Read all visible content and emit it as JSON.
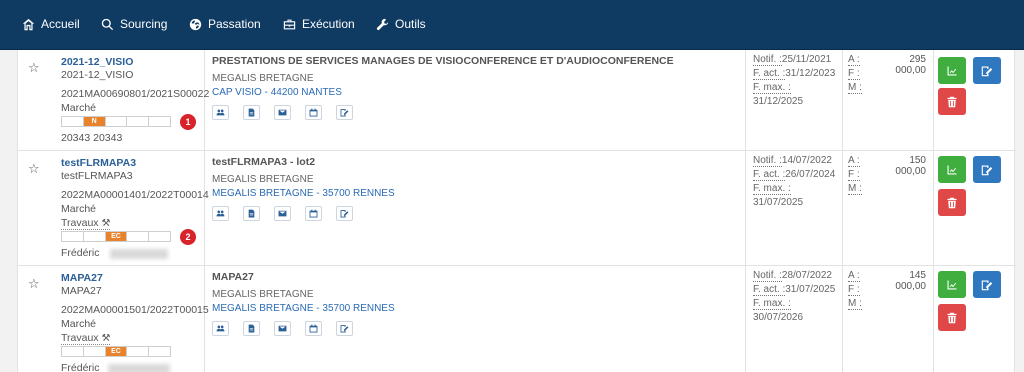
{
  "nav": {
    "items": [
      {
        "label": "Accueil",
        "icon": "home-icon"
      },
      {
        "label": "Sourcing",
        "icon": "search-icon"
      },
      {
        "label": "Passation",
        "icon": "globe-icon"
      },
      {
        "label": "Exécution",
        "icon": "briefcase-icon"
      },
      {
        "label": "Outils",
        "icon": "wrench-icon"
      }
    ]
  },
  "rows": [
    {
      "ref": "2021-12_VISIO",
      "ref_sub": "2021-12_VISIO",
      "number": "2021MA00690801/2021S00022",
      "type": "Marché",
      "category": "",
      "progress": [
        "",
        "N",
        "",
        "",
        ""
      ],
      "progress_active": 1,
      "badge": "1",
      "owner": "20343 20343",
      "title": "PRESTATIONS DE SERVICES MANAGES DE VISIOCONFERENCE ET D'AUDIOCONFERENCE",
      "buyer": "MEGALIS BRETAGNE",
      "supplier": "CAP VISIO - 44200 NANTES",
      "notif_label": "Notif. :",
      "notif": "25/11/2021",
      "fact_label": "F. act. :",
      "fact": "31/12/2023",
      "fmax_label": "F. max. :",
      "fmax": "31/12/2025",
      "amount_labels": [
        "A :",
        "F :",
        "M :"
      ],
      "amount": "295 000,00"
    },
    {
      "ref": "testFLRMAPA3",
      "ref_sub": "testFLRMAPA3",
      "number": "2022MA00001401/2022T00014",
      "type": "Marché",
      "category": "Travaux",
      "progress": [
        "",
        "",
        "EC",
        "",
        ""
      ],
      "progress_active": 2,
      "badge": "2",
      "owner": "Frédéric",
      "title": "testFLRMAPA3 - lot2",
      "buyer": "MEGALIS BRETAGNE",
      "supplier": "MEGALIS BRETAGNE - 35700 RENNES",
      "notif_label": "Notif. :",
      "notif": "14/07/2022",
      "fact_label": "F. act. :",
      "fact": "26/07/2024",
      "fmax_label": "F. max. :",
      "fmax": "31/07/2025",
      "amount_labels": [
        "A :",
        "F :",
        "M :"
      ],
      "amount": "150 000,00"
    },
    {
      "ref": "MAPA27",
      "ref_sub": "MAPA27",
      "number": "2022MA00001501/2022T00015",
      "type": "Marché",
      "category": "Travaux",
      "progress": [
        "",
        "",
        "EC",
        "",
        ""
      ],
      "progress_active": 2,
      "badge": "",
      "owner": "Frédéric",
      "title": "MAPA27",
      "buyer": "MEGALIS BRETAGNE",
      "supplier": "MEGALIS BRETAGNE - 35700 RENNES",
      "notif_label": "Notif. :",
      "notif": "28/07/2022",
      "fact_label": "F. act. :",
      "fact": "31/07/2025",
      "fmax_label": "F. max. :",
      "fmax": "30/07/2026",
      "amount_labels": [
        "A :",
        "F :",
        "M :"
      ],
      "amount": "145 000,00"
    }
  ],
  "colors": {
    "nav_bg": "#0f3a61",
    "link": "#2a5f97",
    "progress_on": "#e8832b",
    "btn_green": "#3fae3f",
    "btn_blue": "#2f78c0",
    "btn_red": "#e04848",
    "badge": "#d8232a"
  }
}
